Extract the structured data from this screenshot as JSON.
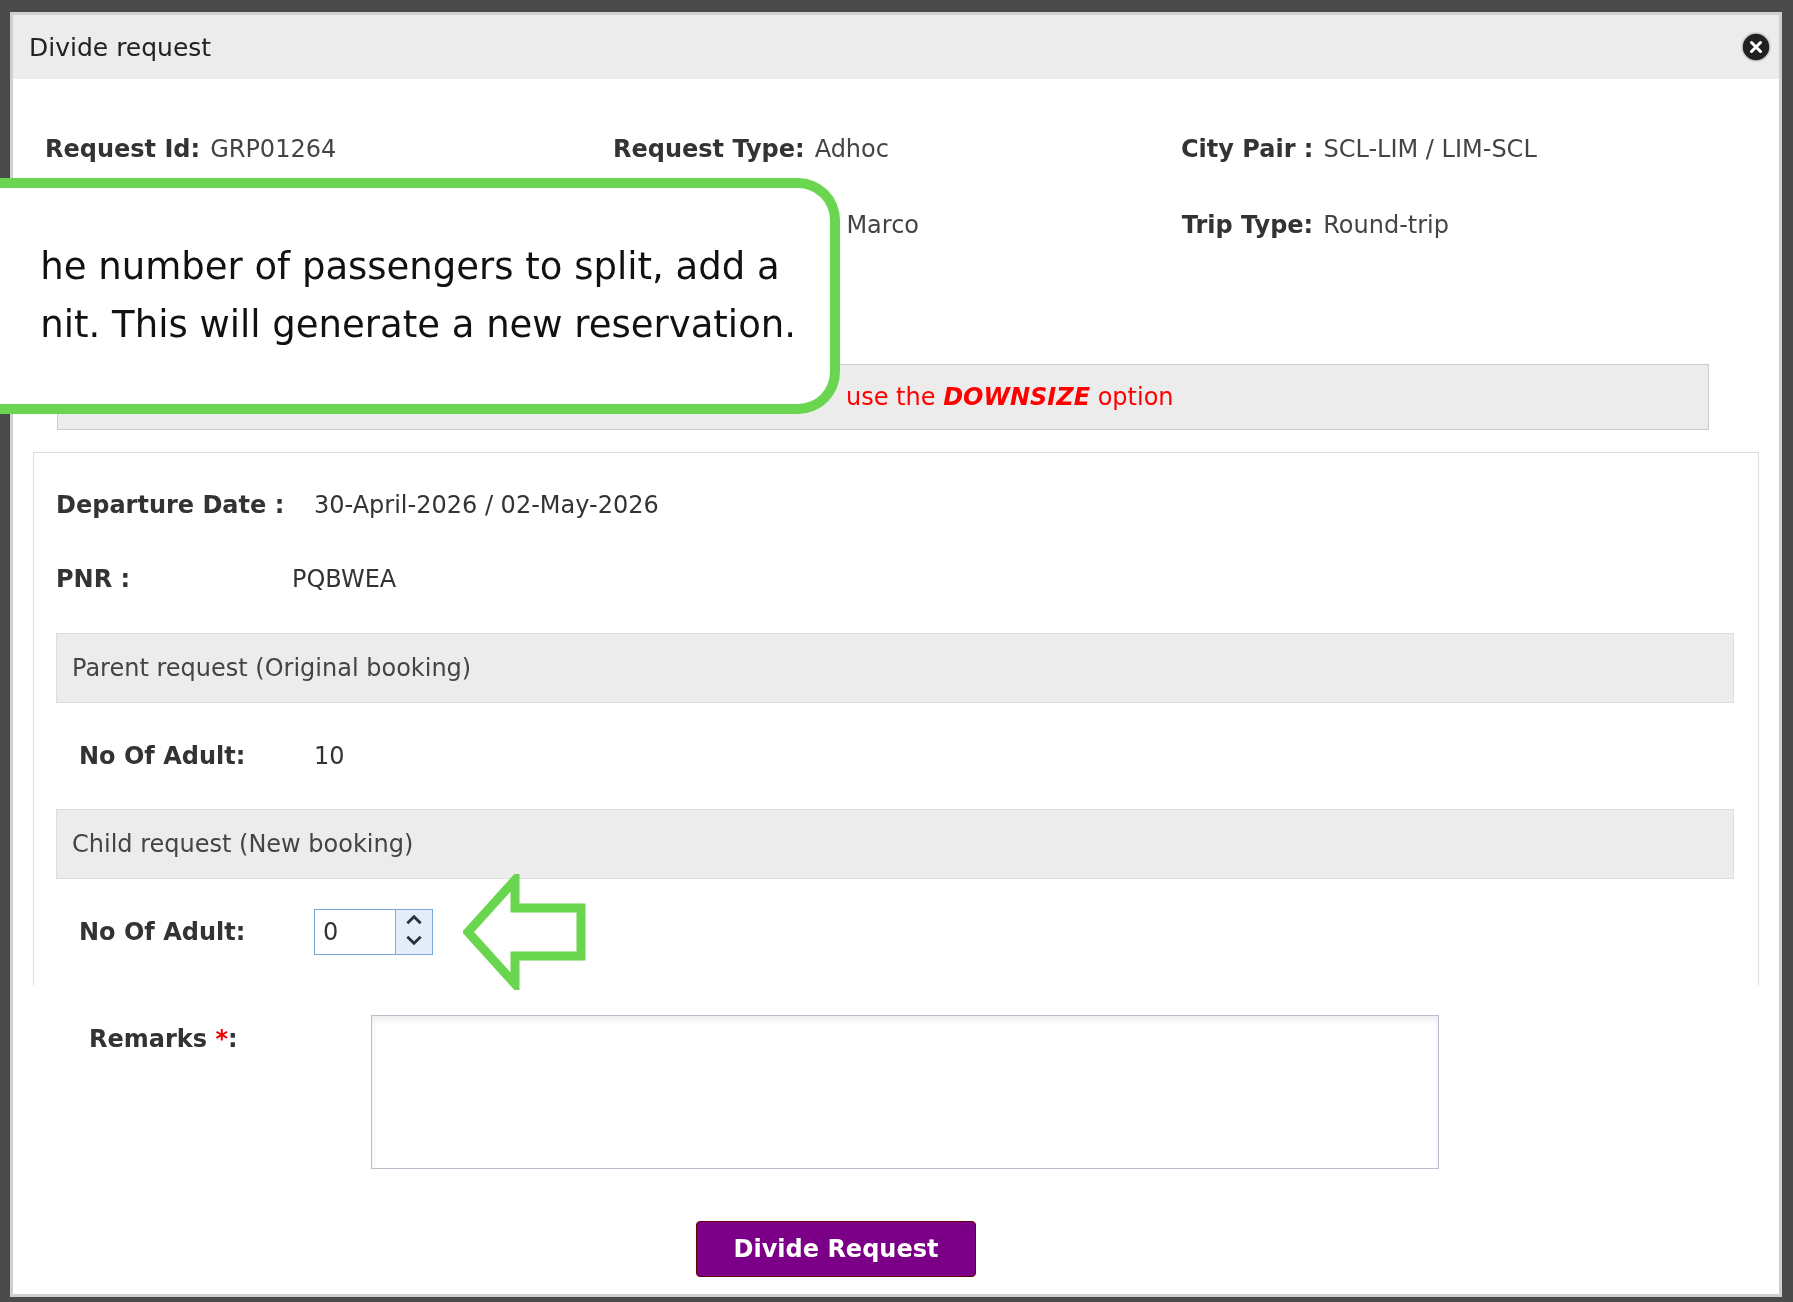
{
  "window": {
    "title": "Divide request"
  },
  "summary": [
    {
      "label": "Request Id:",
      "value": "GRP01264"
    },
    {
      "label": "Request Type:",
      "value": "Adhoc"
    },
    {
      "label": "City Pair :",
      "value": "SCL-LIM / LIM-SCL"
    },
    {
      "value": "Marco"
    },
    {
      "label": "Trip Type:",
      "value": "Round-trip"
    }
  ],
  "note": {
    "text": "use the **DOWNSIZE** option"
  },
  "details": [
    {
      "label": "Departure Date :",
      "value": "30-April-2026 / 02-May-2026"
    },
    {
      "label": "PNR :",
      "value": "PQBWEA"
    }
  ],
  "sections": [
    {
      "title": "Parent request (Original booking)",
      "field": {
        "kind": "text",
        "label": "No Of Adult:",
        "value": "10"
      }
    },
    {
      "title": "Child request (New booking)",
      "field": {
        "kind": "spinner",
        "label": "No Of Adult:",
        "value": "0"
      }
    }
  ],
  "remarks": {
    "label": "Remarks",
    "required_mark": "*",
    "suffix": ":"
  },
  "submit": {
    "label": "Divide Request"
  },
  "callout": {
    "lines": [
      "he number of passengers to split, add a",
      "nit. This will generate a new reservation."
    ]
  }
}
